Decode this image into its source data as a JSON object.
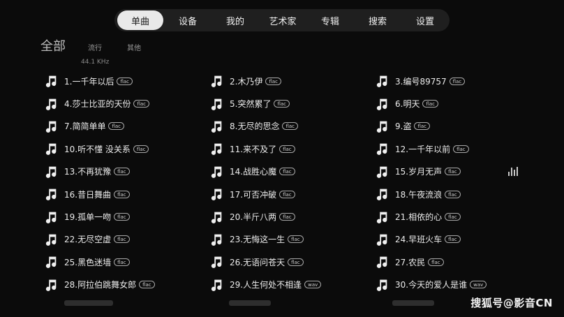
{
  "nav": {
    "tabs": [
      {
        "label": "单曲",
        "active": true
      },
      {
        "label": "设备",
        "active": false
      },
      {
        "label": "我的",
        "active": false
      },
      {
        "label": "艺术家",
        "active": false
      },
      {
        "label": "专辑",
        "active": false
      },
      {
        "label": "搜索",
        "active": false
      },
      {
        "label": "设置",
        "active": false
      }
    ]
  },
  "filters": {
    "all": "全部",
    "popular": "流行",
    "other": "其他",
    "sample_rate": "44.1 KHz"
  },
  "songs": [
    {
      "title": "1.一千年以后",
      "format": "flac"
    },
    {
      "title": "2.木乃伊",
      "format": "flac"
    },
    {
      "title": "3.编号89757",
      "format": "flac"
    },
    {
      "title": "4.莎士比亚的天份",
      "format": "flac"
    },
    {
      "title": "5.突然累了",
      "format": "flac"
    },
    {
      "title": "6.明天",
      "format": "flac"
    },
    {
      "title": "7.简简单单",
      "format": "flac"
    },
    {
      "title": "8.无尽的思念",
      "format": "flac"
    },
    {
      "title": "9.盗",
      "format": "flac"
    },
    {
      "title": "10.听不懂 没关系",
      "format": "flac"
    },
    {
      "title": "11.来不及了",
      "format": "flac"
    },
    {
      "title": "12.一千年以前",
      "format": "flac"
    },
    {
      "title": "13.不再犹豫",
      "format": "flac"
    },
    {
      "title": "14.战胜心魔",
      "format": "flac"
    },
    {
      "title": "15.岁月无声",
      "format": "flac"
    },
    {
      "title": "16.昔日舞曲",
      "format": "flac"
    },
    {
      "title": "17.可否冲破",
      "format": "flac"
    },
    {
      "title": "18.午夜流浪",
      "format": "flac"
    },
    {
      "title": "19.孤单一吻",
      "format": "flac"
    },
    {
      "title": "20.半斤八两",
      "format": "flac"
    },
    {
      "title": "21.相依的心",
      "format": "flac"
    },
    {
      "title": "22.无尽空虚",
      "format": "flac"
    },
    {
      "title": "23.无悔这一生",
      "format": "flac"
    },
    {
      "title": "24.早班火车",
      "format": "flac"
    },
    {
      "title": "25.黑色迷墙",
      "format": "flac"
    },
    {
      "title": "26.无语问苍天",
      "format": "flac"
    },
    {
      "title": "27.农民",
      "format": "flac"
    },
    {
      "title": "28.阿拉伯跳舞女郎",
      "format": "flac"
    },
    {
      "title": "29.人生何处不相逢",
      "format": "wav"
    },
    {
      "title": "30.今天的爱人是谁",
      "format": "wav"
    }
  ],
  "now_playing_icon": "equalizer-bars-icon",
  "watermark": "搜狐号@影音CN",
  "colors": {
    "background": "#0b0b0b",
    "nav_bg": "#1f1f1f",
    "active_tab": "#e9e9e9"
  }
}
